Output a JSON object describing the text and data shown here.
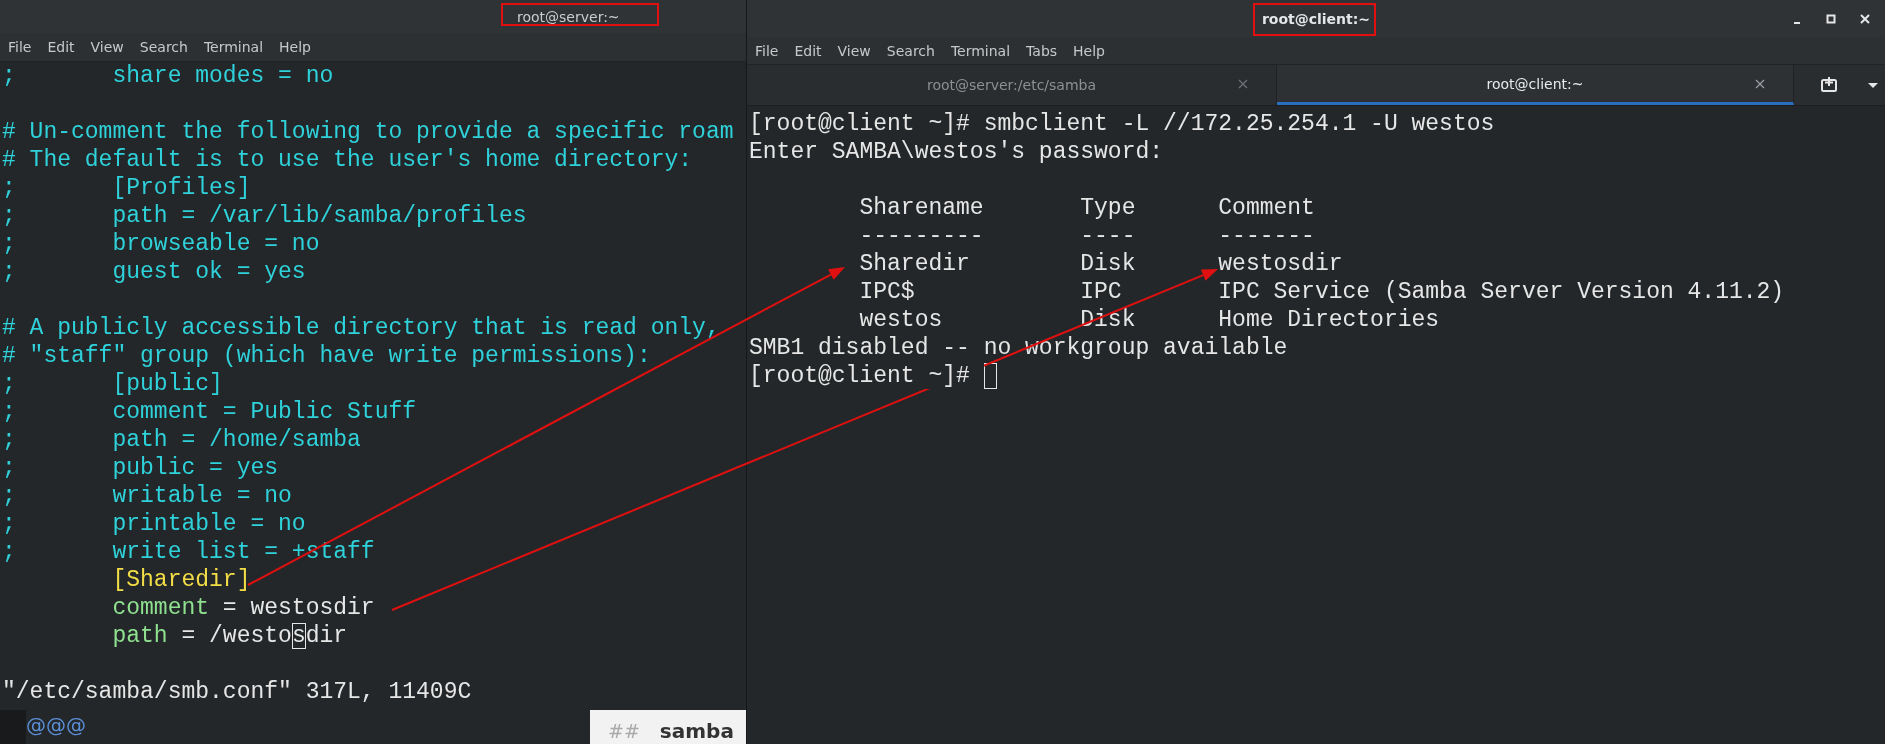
{
  "server_window": {
    "title": "root@server:~",
    "menu": [
      "File",
      "Edit",
      "View",
      "Search",
      "Terminal",
      "Help"
    ],
    "lines": [
      {
        "kind": "text",
        "segments": [
          {
            "kind": "comment",
            "text": ";       share modes = no"
          }
        ]
      },
      {
        "kind": "blank"
      },
      {
        "kind": "text",
        "segments": [
          {
            "kind": "comment",
            "text": "# Un-comment the following to provide a specific roam"
          }
        ]
      },
      {
        "kind": "text",
        "segments": [
          {
            "kind": "comment",
            "text": "# The default is to use the user's home directory:"
          }
        ]
      },
      {
        "kind": "text",
        "segments": [
          {
            "kind": "comment",
            "text": ";       [Profiles]"
          }
        ]
      },
      {
        "kind": "text",
        "segments": [
          {
            "kind": "comment",
            "text": ";       path = /var/lib/samba/profiles"
          }
        ]
      },
      {
        "kind": "text",
        "segments": [
          {
            "kind": "comment",
            "text": ";       browseable = no"
          }
        ]
      },
      {
        "kind": "text",
        "segments": [
          {
            "kind": "comment",
            "text": ";       guest ok = yes"
          }
        ]
      },
      {
        "kind": "blank"
      },
      {
        "kind": "text",
        "segments": [
          {
            "kind": "comment",
            "text": "# A publicly accessible directory that is read only,"
          }
        ]
      },
      {
        "kind": "text",
        "segments": [
          {
            "kind": "comment",
            "text": "# \"staff\" group (which have write permissions):"
          }
        ]
      },
      {
        "kind": "text",
        "segments": [
          {
            "kind": "comment",
            "text": ";       [public]"
          }
        ]
      },
      {
        "kind": "text",
        "segments": [
          {
            "kind": "comment",
            "text": ";       comment = Public Stuff"
          }
        ]
      },
      {
        "kind": "text",
        "segments": [
          {
            "kind": "comment",
            "text": ";       path = /home/samba"
          }
        ]
      },
      {
        "kind": "text",
        "segments": [
          {
            "kind": "comment",
            "text": ";       public = yes"
          }
        ]
      },
      {
        "kind": "text",
        "segments": [
          {
            "kind": "comment",
            "text": ";       writable = no"
          }
        ]
      },
      {
        "kind": "text",
        "segments": [
          {
            "kind": "comment",
            "text": ";       printable = no"
          }
        ]
      },
      {
        "kind": "text",
        "segments": [
          {
            "kind": "comment",
            "text": ";       write list = +staff"
          }
        ]
      },
      {
        "kind": "text",
        "segments": [
          {
            "kind": "section",
            "text": "        [Sharedir]"
          }
        ]
      },
      {
        "kind": "text",
        "segments": [
          {
            "kind": "key",
            "text": "        comment"
          },
          {
            "kind": "plain",
            "text": " = westosdir"
          }
        ]
      },
      {
        "kind": "text",
        "segments": [
          {
            "kind": "key",
            "text": "        path"
          },
          {
            "kind": "plain",
            "text": " = /westo"
          },
          {
            "kind": "cursor",
            "text": "s"
          },
          {
            "kind": "plain",
            "text": "dir"
          }
        ]
      },
      {
        "kind": "blank"
      },
      {
        "kind": "text",
        "segments": [
          {
            "kind": "plain",
            "text": "\"/etc/samba/smb.conf\" 317L, 11409C"
          }
        ]
      }
    ]
  },
  "background": {
    "text_1": "@@@",
    "heading_mark": "##",
    "heading": "samba"
  },
  "client_window": {
    "title": "root@client:~",
    "menu": [
      "File",
      "Edit",
      "View",
      "Search",
      "Terminal",
      "Tabs",
      "Help"
    ],
    "tabs": [
      {
        "label": "root@server:/etc/samba",
        "selected": false
      },
      {
        "label": "root@client:~",
        "selected": true
      }
    ],
    "lines": [
      {
        "kind": "text",
        "segments": [
          {
            "kind": "plain",
            "text": "[root@client ~]# smbclient -L //172.25.254.1 -U westos"
          }
        ]
      },
      {
        "kind": "text",
        "segments": [
          {
            "kind": "plain",
            "text": "Enter SAMBA\\westos's password:"
          }
        ]
      },
      {
        "kind": "blank"
      },
      {
        "kind": "text",
        "segments": [
          {
            "kind": "plain",
            "text": "        Sharename       Type      Comment"
          }
        ]
      },
      {
        "kind": "text",
        "segments": [
          {
            "kind": "plain",
            "text": "        ---------       ----      -------"
          }
        ]
      },
      {
        "kind": "text",
        "segments": [
          {
            "kind": "plain",
            "text": "        Sharedir        Disk      westosdir"
          }
        ]
      },
      {
        "kind": "text",
        "segments": [
          {
            "kind": "plain",
            "text": "        IPC$            IPC       IPC Service (Samba Server Version 4.11.2)"
          }
        ]
      },
      {
        "kind": "text",
        "segments": [
          {
            "kind": "plain",
            "text": "        westos          Disk      Home Directories"
          }
        ]
      },
      {
        "kind": "text",
        "segments": [
          {
            "kind": "plain",
            "text": "SMB1 disabled -- no workgroup available"
          }
        ]
      },
      {
        "kind": "text",
        "segments": [
          {
            "kind": "plain",
            "text": "[root@client ~]# "
          },
          {
            "kind": "cursor"
          }
        ]
      }
    ]
  }
}
